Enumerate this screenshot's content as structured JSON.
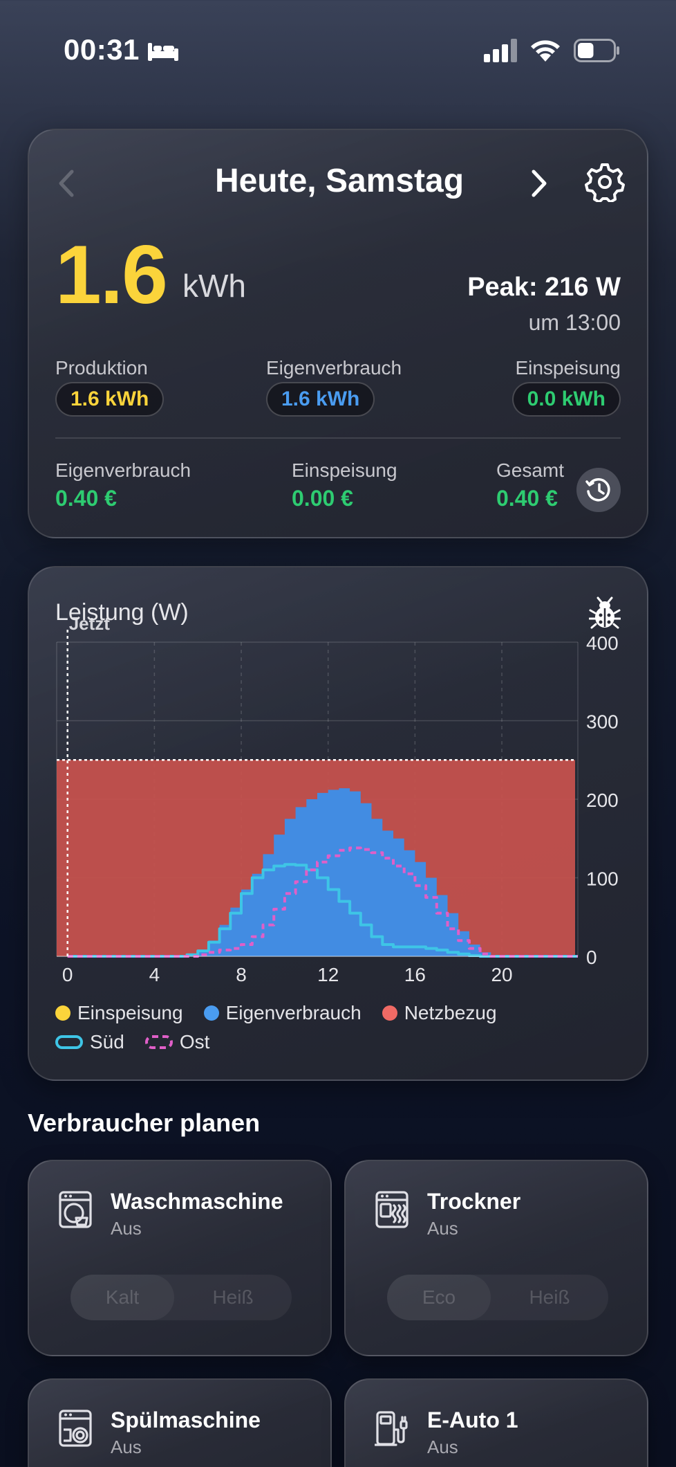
{
  "status_bar": {
    "time": "00:31",
    "focus_icon": "bed-icon",
    "signal_icon": "cellular-signal-icon",
    "wifi_icon": "wifi-icon",
    "battery_icon": "battery-icon",
    "battery_level": 0.45
  },
  "summary": {
    "title": "Heute, Samstag",
    "total_value": "1.6",
    "total_unit": "kWh",
    "peak": "Peak: 216 W",
    "peak_time": "um 13:00",
    "stats": [
      {
        "label": "Produktion",
        "value": "1.6 kWh",
        "color": "#fbd43b"
      },
      {
        "label": "Eigenverbrauch",
        "value": "1.6 kWh",
        "color": "#4a9cf0"
      },
      {
        "label": "Einspeisung",
        "value": "0.0 kWh",
        "color": "#2ecc71"
      }
    ],
    "money": [
      {
        "label": "Eigenverbrauch",
        "value": "0.40 €"
      },
      {
        "label": "Einspeisung",
        "value": "0.00 €"
      },
      {
        "label": "Gesamt",
        "value": "0.40 €"
      }
    ]
  },
  "chart_card": {
    "title": "Leistung (W)",
    "now_label": "Jetzt",
    "legend": [
      {
        "label": "Einspeisung",
        "color": "#fbd43b"
      },
      {
        "label": "Eigenverbrauch",
        "color": "#4a9cf0"
      },
      {
        "label": "Netzbezug",
        "color": "#f06a65"
      }
    ],
    "legend_lines": [
      {
        "label": "Süd",
        "color": "#3ec5e6"
      },
      {
        "label": "Ost",
        "color": "#e05fc8"
      }
    ]
  },
  "chart_data": {
    "type": "area",
    "ylabel": "Leistung (W)",
    "ylim": [
      0,
      400
    ],
    "xlim": [
      -0.5,
      23.5
    ],
    "x_ticks": [
      0,
      4,
      8,
      12,
      16,
      20
    ],
    "y_ticks": [
      0,
      100,
      200,
      300,
      400
    ],
    "grid": true,
    "now_x": 0,
    "netzbezug_level": 250,
    "x": [
      0,
      1,
      2,
      3,
      4,
      5,
      5.5,
      6,
      6.5,
      7,
      7.5,
      8,
      8.5,
      9,
      9.5,
      10,
      10.5,
      11,
      11.5,
      12,
      12.5,
      13,
      13.5,
      14,
      14.5,
      15,
      15.5,
      16,
      16.5,
      17,
      17.5,
      18,
      18.5,
      19,
      19.5,
      20,
      21,
      22,
      23
    ],
    "series": [
      {
        "name": "Eigenverbrauch",
        "values": [
          0,
          0,
          0,
          0,
          0,
          0,
          2,
          8,
          20,
          40,
          62,
          85,
          105,
          130,
          155,
          175,
          190,
          200,
          208,
          212,
          214,
          210,
          195,
          175,
          160,
          150,
          135,
          120,
          100,
          78,
          55,
          32,
          15,
          5,
          0,
          0,
          0,
          0,
          0
        ]
      },
      {
        "name": "Süd",
        "values": [
          0,
          0,
          0,
          0,
          0,
          0,
          2,
          7,
          18,
          35,
          55,
          80,
          100,
          110,
          115,
          117,
          116,
          110,
          100,
          85,
          70,
          55,
          40,
          25,
          15,
          12,
          12,
          12,
          10,
          8,
          5,
          3,
          1,
          0,
          0,
          0,
          0,
          0,
          0
        ]
      },
      {
        "name": "Ost",
        "values": [
          0,
          0,
          0,
          0,
          0,
          0,
          0,
          2,
          5,
          8,
          10,
          15,
          25,
          40,
          60,
          80,
          95,
          110,
          120,
          128,
          135,
          138,
          136,
          132,
          125,
          115,
          105,
          90,
          75,
          55,
          35,
          20,
          10,
          3,
          0,
          0,
          0,
          0,
          0
        ]
      }
    ]
  },
  "consumers_section": {
    "title": "Verbraucher planen",
    "devices": [
      {
        "name": "Waschmaschine",
        "status": "Aus",
        "icon": "washing-machine-icon",
        "modes": [
          "Kalt",
          "Heiß"
        ]
      },
      {
        "name": "Trockner",
        "status": "Aus",
        "icon": "dryer-icon",
        "modes": [
          "Eco",
          "Heiß"
        ]
      },
      {
        "name": "Spülmaschine",
        "status": "Aus",
        "icon": "dishwasher-icon",
        "modes": []
      },
      {
        "name": "E-Auto 1",
        "status": "Aus",
        "icon": "ev-charger-icon",
        "modes": []
      }
    ]
  }
}
